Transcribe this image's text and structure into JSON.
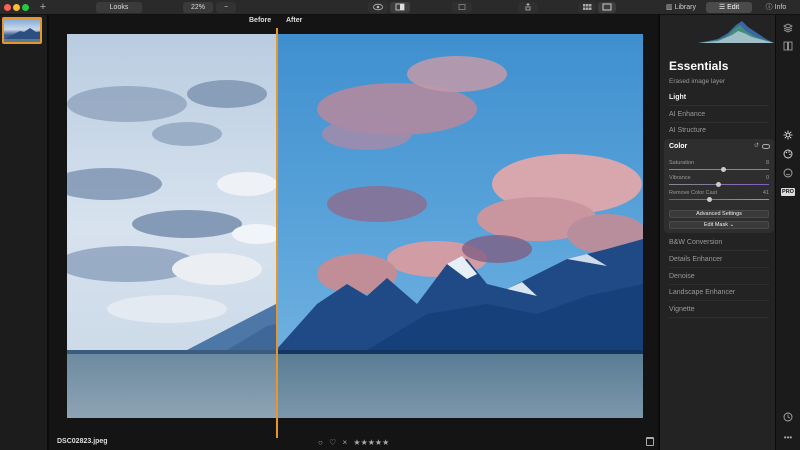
{
  "toolbar": {
    "new_label": "+",
    "looks_label": "Looks",
    "zoom_value": "22%",
    "zoom_out_label": "−",
    "tabs": {
      "library": "Library",
      "edit": "Edit",
      "info": "Info"
    }
  },
  "canvas": {
    "before_label": "Before",
    "after_label": "After",
    "filename": "DSC02823.jpeg",
    "rating_stars": "★★★★★",
    "reject_icon": "×",
    "favorite_icon": "♡",
    "circle_icon": "○"
  },
  "panel": {
    "title": "Essentials",
    "subtitle": "Erased image layer",
    "sections": {
      "light": "Light",
      "ai_enhance": "AI Enhance",
      "ai_structure": "AI Structure",
      "bw": "B&W Conversion",
      "details": "Details Enhancer",
      "denoise": "Denoise",
      "landscape": "Landscape Enhancer",
      "vignette": "Vignette"
    },
    "color": {
      "title": "Color",
      "saturation_label": "Saturation",
      "saturation_value": "8",
      "vibrance_label": "Vibrance",
      "vibrance_value": "0",
      "remove_cast_label": "Remove Color Cast",
      "remove_cast_value": "41",
      "advanced_button": "Advanced Settings",
      "mask_button": "Edit Mask ⌄"
    }
  },
  "colors": {
    "accent": "#e8962b",
    "panel_bg": "#232323",
    "app_bg": "#0c0c0c"
  },
  "icons": {
    "layers": "layers-icon",
    "compare": "compare-icon",
    "essentials": "sun-icon",
    "creative": "palette-icon",
    "portrait": "face-icon",
    "pro": "PRO",
    "history": "clock-icon",
    "more": "more-icon"
  }
}
